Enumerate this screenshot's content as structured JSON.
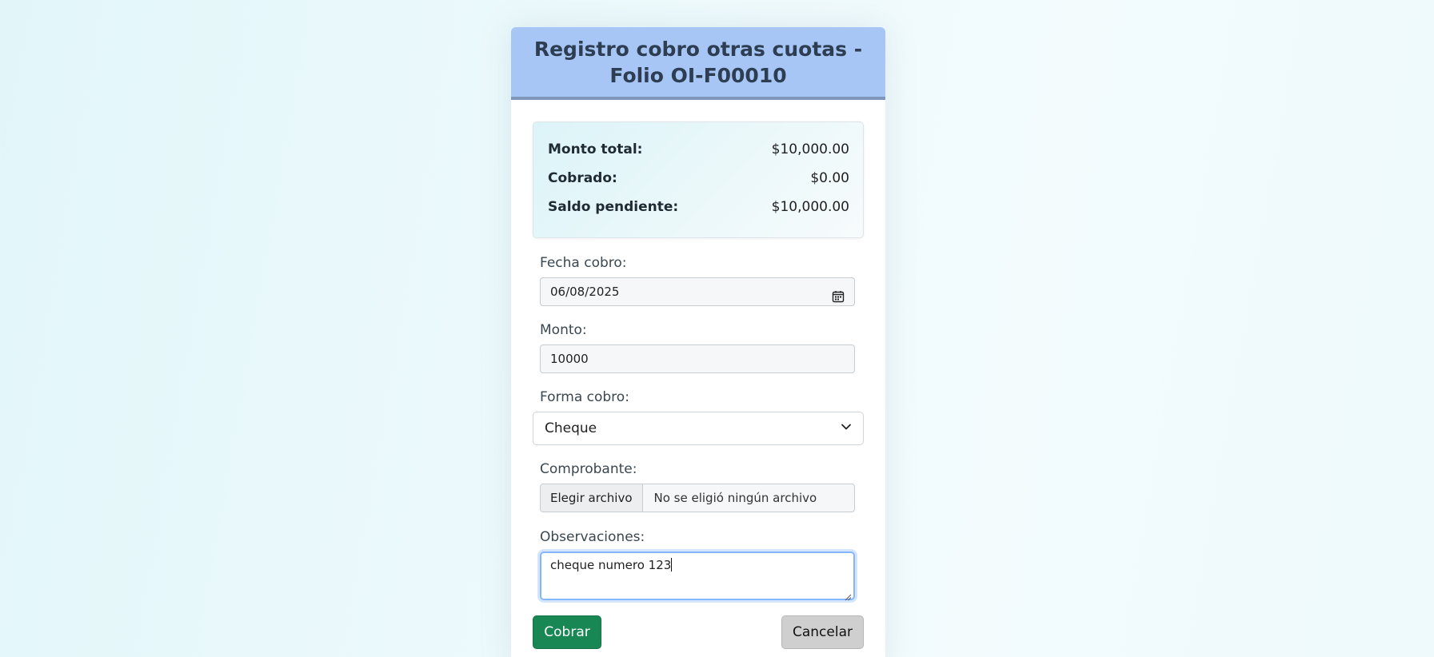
{
  "header": {
    "title": "Registro cobro otras cuotas - Folio OI-F00010"
  },
  "summary": {
    "rows": [
      {
        "label": "Monto total:",
        "value": "$10,000.00"
      },
      {
        "label": "Cobrado:",
        "value": "$0.00"
      },
      {
        "label": "Saldo pendiente:",
        "value": "$10,000.00"
      }
    ]
  },
  "form": {
    "fecha_label": "Fecha cobro:",
    "fecha_value": "06/08/2025",
    "monto_label": "Monto:",
    "monto_value": "10000",
    "forma_label": "Forma cobro:",
    "forma_value": "Cheque",
    "comprobante_label": "Comprobante:",
    "file_button": "Elegir archivo",
    "file_status": "No se eligió ningún archivo",
    "observaciones_label": "Observaciones:",
    "observaciones_value": "cheque numero 123"
  },
  "actions": {
    "submit_label": "Cobrar",
    "cancel_label": "Cancelar"
  },
  "colors": {
    "header_bg": "#a7c6f5",
    "submit_bg": "#198754",
    "cancel_bg": "#cfcfcf"
  },
  "icons": {
    "date": "calendar-icon",
    "select": "chevron-down-icon",
    "textarea": "resize-handle-icon"
  }
}
